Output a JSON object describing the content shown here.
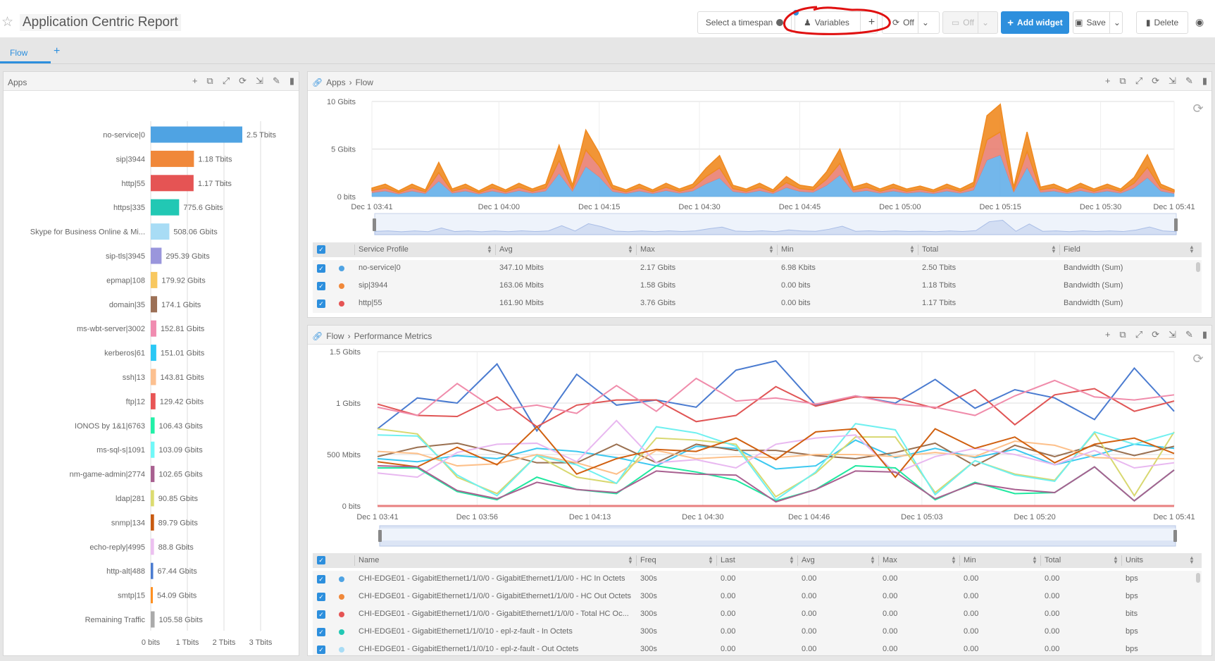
{
  "header": {
    "title": "Application Centric Report",
    "timespan_label": "Select a timespan",
    "variables_label": "Variables",
    "add_label": "+",
    "refresh_label": "Off",
    "presentation_label": "Off",
    "add_widget_label": "Add widget",
    "save_label": "Save",
    "delete_label": "Delete",
    "accent_color": "#2d8fdd",
    "annotation_color": "#e01010"
  },
  "tabs": [
    {
      "label": "Flow",
      "active": true
    }
  ],
  "tab_add_label": "+",
  "panel_icons": [
    "plus-icon",
    "copy-icon",
    "expand-icon",
    "refresh-icon",
    "export-icon",
    "edit-icon",
    "trash-icon"
  ],
  "panels": {
    "apps": {
      "title": "Apps"
    },
    "flow": {
      "crumbs": [
        "Apps",
        "Flow"
      ]
    },
    "perf": {
      "crumbs": [
        "Flow",
        "Performance Metrics"
      ]
    }
  },
  "chart_data": [
    {
      "type": "bar",
      "orientation": "horizontal",
      "categories": [
        "no-service|0",
        "sip|3944",
        "http|55",
        "https|335",
        "Skype for Business Online & Mi...",
        "sip-tls|3945",
        "epmap|108",
        "domain|35",
        "ms-wbt-server|3002",
        "kerberos|61",
        "ssh|13",
        "ftp|12",
        "IONOS by 1&1|6763",
        "ms-sql-s|1091",
        "nm-game-admin|2774",
        "ldap|281",
        "snmp|134",
        "echo-reply|4995",
        "http-alt|488",
        "smtp|15",
        "Remaining Traffic"
      ],
      "values_gbits": [
        2500,
        1180,
        1170,
        775.6,
        508.06,
        295.39,
        179.92,
        174.1,
        152.81,
        151.01,
        143.81,
        129.42,
        106.43,
        103.09,
        102.65,
        90.85,
        89.79,
        88.8,
        67.44,
        54.09,
        105.58
      ],
      "data_labels": [
        "2.5 Tbits",
        "1.18 Tbits",
        "1.17 Tbits",
        "775.6 Gbits",
        "508.06 Gbits",
        "295.39 Gbits",
        "179.92 Gbits",
        "174.1 Gbits",
        "152.81 Gbits",
        "151.01 Gbits",
        "143.81 Gbits",
        "129.42 Gbits",
        "106.43 Gbits",
        "103.09 Gbits",
        "102.65 Gbits",
        "90.85 Gbits",
        "89.79 Gbits",
        "88.8 Gbits",
        "67.44 Gbits",
        "54.09 Gbits",
        "105.58 Gbits"
      ],
      "colors": [
        "#4fa3e3",
        "#f0883a",
        "#e55454",
        "#22c8b4",
        "#a8dcf5",
        "#9a96dc",
        "#f8c860",
        "#9c7056",
        "#f08cb0",
        "#2ac8f5",
        "#fcc090",
        "#e85555",
        "#22f0a8",
        "#70f8f8",
        "#a86090",
        "#dcdc70",
        "#c85a10",
        "#ecc0f0",
        "#4a7bd0",
        "#ff9020",
        "#aaaaaa"
      ],
      "xticks": [
        "0 bits",
        "1 Tbits",
        "2 Tbits",
        "3 Tbits"
      ],
      "xlim_tbits": [
        0,
        3
      ],
      "grid": true
    },
    {
      "type": "area",
      "stacked": true,
      "x_start": "Dec 1 03:41",
      "x_step_minutes": 2,
      "xticks": [
        "Dec 1 03:41",
        "Dec 1 04:00",
        "Dec 1 04:15",
        "Dec 1 04:30",
        "Dec 1 04:45",
        "Dec 1 05:00",
        "Dec 1 05:15",
        "Dec 1 05:30",
        "Dec 1 05:41"
      ],
      "yticks": [
        "10 Gbits",
        "5 Gbits",
        "0 bits"
      ],
      "ylim_gbits": [
        0,
        10
      ],
      "grid": true,
      "series": [
        {
          "name": "no-service|0",
          "color": "#5aaae8",
          "values": [
            0.41,
            0.59,
            0.27,
            0.59,
            0.32,
            1.62,
            0.36,
            0.59,
            0.27,
            0.59,
            0.32,
            0.63,
            0.36,
            0.59,
            2.43,
            0.54,
            3.15,
            2.07,
            0.54,
            0.32,
            0.59,
            0.32,
            0.63,
            0.36,
            0.59,
            1.35,
            1.94,
            0.54,
            0.36,
            0.63,
            0.32,
            0.95,
            0.54,
            0.45,
            1.17,
            2.25,
            0.45,
            0.63,
            0.36,
            0.59,
            0.36,
            0.5,
            0.32,
            0.59,
            0.36,
            0.68,
            3.83,
            4.37,
            0.45,
            3.06,
            0.45,
            0.59,
            0.32,
            0.63,
            0.36,
            0.59,
            0.36,
            0.9,
            1.98,
            0.59,
            0.32
          ]
        },
        {
          "name": "http|55",
          "color": "#e8786a",
          "values": [
            0.22,
            0.33,
            0.15,
            0.33,
            0.18,
            0.9,
            0.2,
            0.33,
            0.15,
            0.33,
            0.18,
            0.35,
            0.2,
            0.33,
            1.35,
            0.3,
            1.75,
            1.15,
            0.3,
            0.18,
            0.33,
            0.18,
            0.35,
            0.2,
            0.33,
            0.75,
            1.08,
            0.3,
            0.2,
            0.35,
            0.18,
            0.53,
            0.3,
            0.25,
            0.65,
            1.25,
            0.25,
            0.35,
            0.2,
            0.33,
            0.2,
            0.28,
            0.18,
            0.33,
            0.2,
            0.38,
            2.13,
            2.43,
            0.25,
            1.7,
            0.25,
            0.33,
            0.18,
            0.35,
            0.2,
            0.33,
            0.2,
            0.5,
            1.1,
            0.33,
            0.18
          ]
        },
        {
          "name": "sip|3944",
          "color": "#f08a20",
          "values": [
            0.27,
            0.39,
            0.18,
            0.39,
            0.21,
            1.08,
            0.24,
            0.39,
            0.18,
            0.39,
            0.21,
            0.42,
            0.24,
            0.39,
            1.62,
            0.36,
            2.1,
            1.38,
            0.36,
            0.21,
            0.39,
            0.21,
            0.42,
            0.24,
            0.39,
            0.9,
            1.29,
            0.36,
            0.24,
            0.42,
            0.21,
            0.63,
            0.36,
            0.3,
            0.78,
            1.5,
            0.3,
            0.42,
            0.24,
            0.39,
            0.24,
            0.33,
            0.21,
            0.39,
            0.24,
            0.45,
            2.55,
            2.91,
            0.3,
            2.04,
            0.3,
            0.39,
            0.21,
            0.42,
            0.24,
            0.39,
            0.24,
            0.6,
            1.32,
            0.39,
            0.21
          ]
        }
      ]
    },
    {
      "type": "line",
      "x_start": "Dec 1 03:41",
      "x_step_minutes": 6,
      "xticks": [
        "Dec 1 03:41",
        "Dec 1 03:56",
        "Dec 1 04:13",
        "Dec 1 04:30",
        "Dec 1 04:46",
        "Dec 1 05:03",
        "Dec 1 05:20",
        "Dec 1 05:41"
      ],
      "yticks": [
        "1.5 Gbits",
        "1 Gbits",
        "500 Mbits",
        "0 bits"
      ],
      "ylim_mbits": [
        0,
        1500
      ],
      "grid": true,
      "series": [
        {
          "color": "#4a7bd0",
          "values": [
            750,
            1050,
            1000,
            1380,
            730,
            1280,
            980,
            1030,
            960,
            1320,
            1410,
            980,
            1070,
            1000,
            1230,
            950,
            1130,
            1050,
            840,
            1340,
            920
          ]
        },
        {
          "color": "#e05555",
          "values": [
            990,
            880,
            870,
            1060,
            770,
            980,
            1030,
            1030,
            820,
            880,
            1160,
            970,
            1060,
            1050,
            950,
            1130,
            790,
            1080,
            1140,
            920,
            1020
          ]
        },
        {
          "color": "#f08cab",
          "values": [
            960,
            880,
            1190,
            930,
            980,
            900,
            1170,
            920,
            1240,
            1020,
            1050,
            990,
            1070,
            990,
            960,
            880,
            1070,
            1220,
            1060,
            1030,
            1080
          ]
        },
        {
          "color": "#3cc8f0",
          "values": [
            460,
            430,
            490,
            460,
            560,
            530,
            470,
            390,
            580,
            560,
            360,
            390,
            640,
            470,
            560,
            470,
            550,
            400,
            490,
            600,
            560
          ]
        },
        {
          "color": "#9a7050",
          "values": [
            480,
            570,
            610,
            520,
            420,
            420,
            600,
            420,
            600,
            540,
            540,
            490,
            460,
            520,
            610,
            390,
            590,
            480,
            590,
            490,
            580
          ]
        },
        {
          "color": "#fdc08a",
          "values": [
            530,
            510,
            390,
            410,
            500,
            420,
            310,
            540,
            460,
            480,
            470,
            500,
            500,
            480,
            520,
            480,
            630,
            590,
            470,
            460,
            460
          ]
        },
        {
          "color": "#d8d870",
          "values": [
            750,
            700,
            280,
            120,
            490,
            280,
            220,
            660,
            640,
            600,
            90,
            320,
            670,
            670,
            130,
            440,
            310,
            250,
            710,
            100,
            720
          ]
        },
        {
          "color": "#70f0f0",
          "values": [
            690,
            680,
            300,
            100,
            490,
            400,
            220,
            770,
            710,
            580,
            60,
            330,
            800,
            740,
            110,
            440,
            300,
            240,
            720,
            600,
            710
          ]
        },
        {
          "color": "#e8b8f0",
          "values": [
            320,
            280,
            520,
            600,
            610,
            430,
            830,
            420,
            450,
            370,
            600,
            660,
            690,
            320,
            480,
            560,
            500,
            400,
            540,
            370,
            420
          ]
        },
        {
          "color": "#d06010",
          "values": [
            430,
            380,
            570,
            400,
            770,
            310,
            460,
            550,
            530,
            660,
            450,
            720,
            750,
            280,
            750,
            560,
            670,
            420,
            600,
            660,
            510
          ]
        },
        {
          "color": "#20e8a0",
          "values": [
            370,
            370,
            140,
            60,
            280,
            160,
            120,
            390,
            330,
            250,
            50,
            160,
            390,
            370,
            60,
            230,
            120,
            130,
            380,
            50,
            350
          ]
        },
        {
          "color": "#a86090",
          "values": [
            390,
            380,
            150,
            70,
            230,
            160,
            130,
            340,
            310,
            300,
            40,
            160,
            340,
            330,
            70,
            220,
            160,
            130,
            380,
            50,
            350
          ]
        },
        {
          "color": "#e88080",
          "values": [
            0,
            0,
            0,
            0,
            0,
            0,
            0,
            0,
            0,
            0,
            0,
            0,
            0,
            0,
            0,
            0,
            0,
            0,
            0,
            0,
            0
          ]
        }
      ]
    }
  ],
  "flow_table": {
    "columns": [
      "Service Profile",
      "Avg",
      "Max",
      "Min",
      "Total",
      "Field"
    ],
    "rows": [
      {
        "color": "#4fa3e3",
        "cells": [
          "no-service|0",
          "347.10 Mbits",
          "2.17 Gbits",
          "6.98 Kbits",
          "2.50 Tbits",
          "Bandwidth (Sum)"
        ]
      },
      {
        "color": "#f0883a",
        "cells": [
          "sip|3944",
          "163.06 Mbits",
          "1.58 Gbits",
          "0.00 bits",
          "1.18 Tbits",
          "Bandwidth (Sum)"
        ]
      },
      {
        "color": "#e55454",
        "cells": [
          "http|55",
          "161.90 Mbits",
          "3.76 Gbits",
          "0.00 bits",
          "1.17 Tbits",
          "Bandwidth (Sum)"
        ]
      }
    ]
  },
  "perf_table": {
    "columns": [
      "Name",
      "Freq",
      "Last",
      "Avg",
      "Max",
      "Min",
      "Total",
      "Units"
    ],
    "rows": [
      {
        "color": "#4fa3e3",
        "cells": [
          "CHI-EDGE01 - GigabitEthernet1/1/0/0 - GigabitEthernet1/1/0/0 - HC In Octets",
          "300s",
          "0.00",
          "0.00",
          "0.00",
          "0.00",
          "0.00",
          "bps"
        ]
      },
      {
        "color": "#f0883a",
        "cells": [
          "CHI-EDGE01 - GigabitEthernet1/1/0/0 - GigabitEthernet1/1/0/0 - HC Out Octets",
          "300s",
          "0.00",
          "0.00",
          "0.00",
          "0.00",
          "0.00",
          "bps"
        ]
      },
      {
        "color": "#e55454",
        "cells": [
          "CHI-EDGE01 - GigabitEthernet1/1/0/0 - GigabitEthernet1/1/0/0 - Total HC Oc...",
          "300s",
          "0.00",
          "0.00",
          "0.00",
          "0.00",
          "0.00",
          "bits"
        ]
      },
      {
        "color": "#22c8b4",
        "cells": [
          "CHI-EDGE01 - GigabitEthernet1/1/0/10 - epl-z-fault - In Octets",
          "300s",
          "0.00",
          "0.00",
          "0.00",
          "0.00",
          "0.00",
          "bps"
        ]
      },
      {
        "color": "#a8dcf5",
        "cells": [
          "CHI-EDGE01 - GigabitEthernet1/1/0/10 - epl-z-fault - Out Octets",
          "300s",
          "0.00",
          "0.00",
          "0.00",
          "0.00",
          "0.00",
          "bps"
        ]
      }
    ]
  }
}
